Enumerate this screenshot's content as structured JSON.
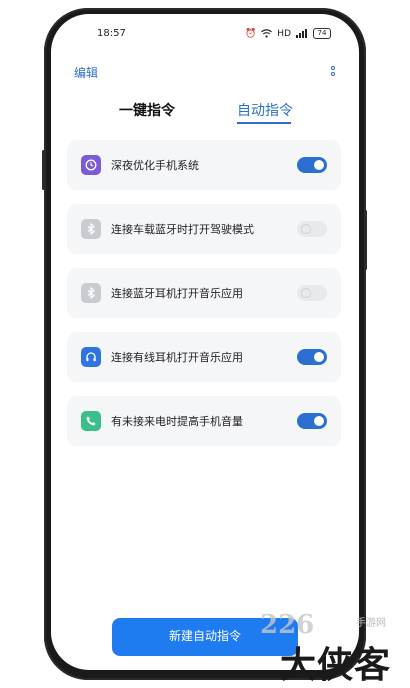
{
  "status": {
    "time": "18:57",
    "hd": "HD",
    "battery": "74"
  },
  "header": {
    "edit_label": "编辑"
  },
  "tabs": [
    {
      "label": "一键指令",
      "active": false
    },
    {
      "label": "自动指令",
      "active": true
    }
  ],
  "items": [
    {
      "label": "深夜优化手机系统",
      "icon": "clock-icon",
      "icon_color": "#7b5bd6",
      "enabled": true
    },
    {
      "label": "连接车载蓝牙时打开驾驶模式",
      "icon": "bluetooth-icon",
      "icon_color": "#c9cbd1",
      "enabled": false
    },
    {
      "label": "连接蓝牙耳机打开音乐应用",
      "icon": "bluetooth-icon",
      "icon_color": "#c9cbd1",
      "enabled": false
    },
    {
      "label": "连接有线耳机打开音乐应用",
      "icon": "headset-icon",
      "icon_color": "#2f74e0",
      "enabled": true
    },
    {
      "label": "有未接来电时提高手机音量",
      "icon": "phone-icon",
      "icon_color": "#3bbf8a",
      "enabled": true
    }
  ],
  "footer": {
    "new_button_label": "新建自动指令"
  },
  "watermark": {
    "number": "226",
    "text": "大侠客",
    "small": "手游网"
  },
  "colors": {
    "accent": "#2b6fd0",
    "button": "#1f7cf0"
  }
}
